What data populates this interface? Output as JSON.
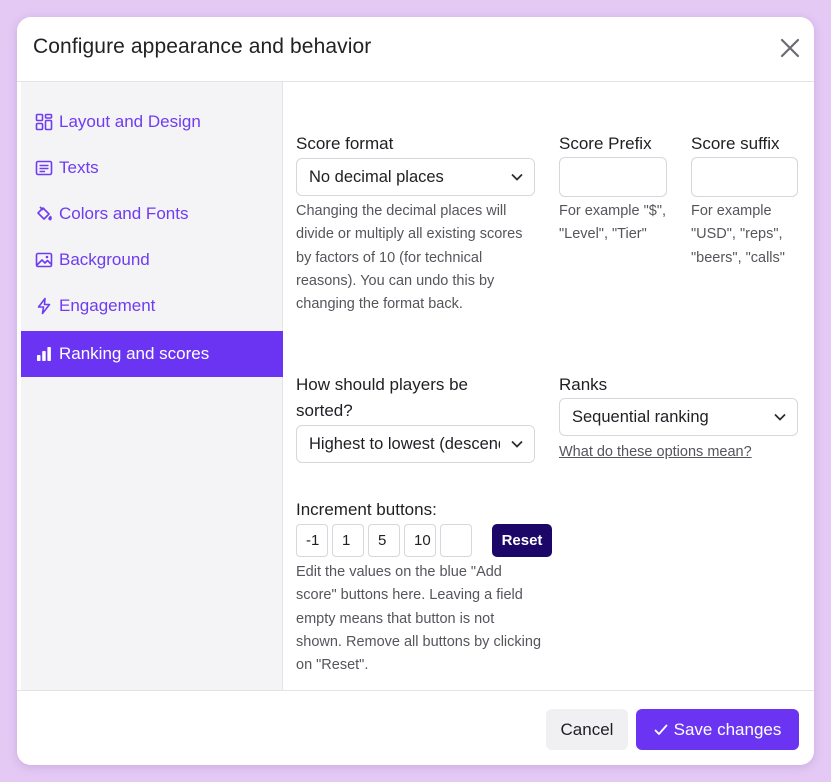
{
  "modal": {
    "title": "Configure appearance and behavior",
    "close_icon": "close-icon"
  },
  "sidebar": {
    "items": [
      {
        "label": "Layout and Design",
        "icon": "layout-grid-icon",
        "active": false
      },
      {
        "label": "Texts",
        "icon": "text-lines-icon",
        "active": false
      },
      {
        "label": "Colors and Fonts",
        "icon": "paint-bucket-icon",
        "active": false
      },
      {
        "label": "Background",
        "icon": "image-icon",
        "active": false
      },
      {
        "label": "Engagement",
        "icon": "lightning-icon",
        "active": false
      },
      {
        "label": "Ranking and scores",
        "icon": "bar-chart-icon",
        "active": true
      }
    ]
  },
  "score_format": {
    "label": "Score format",
    "selected": "No decimal places",
    "help": "Changing the decimal places will divide or multiply all existing scores by factors of 10 (for technical reasons). You can undo this by changing the format back."
  },
  "score_prefix": {
    "label": "Score Prefix",
    "value": "",
    "help": "For example \"$\", \"Level\", \"Tier\""
  },
  "score_suffix": {
    "label": "Score suffix",
    "value": "",
    "help": "For example \"USD\", \"reps\", \"beers\", \"calls\""
  },
  "sorting": {
    "label": "How should players be sorted?",
    "selected": "Highest to lowest (descending)"
  },
  "ranks": {
    "label": "Ranks",
    "selected": "Sequential ranking",
    "link": "What do these options mean?"
  },
  "increment": {
    "label": "Increment buttons:",
    "values": [
      "-1",
      "1",
      "5",
      "10",
      ""
    ],
    "reset_label": "Reset",
    "help": "Edit the values on the blue \"Add score\" buttons here. Leaving a field empty means that button is not shown. Remove all buttons by clicking on \"Reset\"."
  },
  "footer": {
    "cancel_label": "Cancel",
    "save_label": "Save changes"
  },
  "colors": {
    "accent": "#6a34f2",
    "reset_button": "#1c0667",
    "backdrop": "#e4c9f5"
  }
}
